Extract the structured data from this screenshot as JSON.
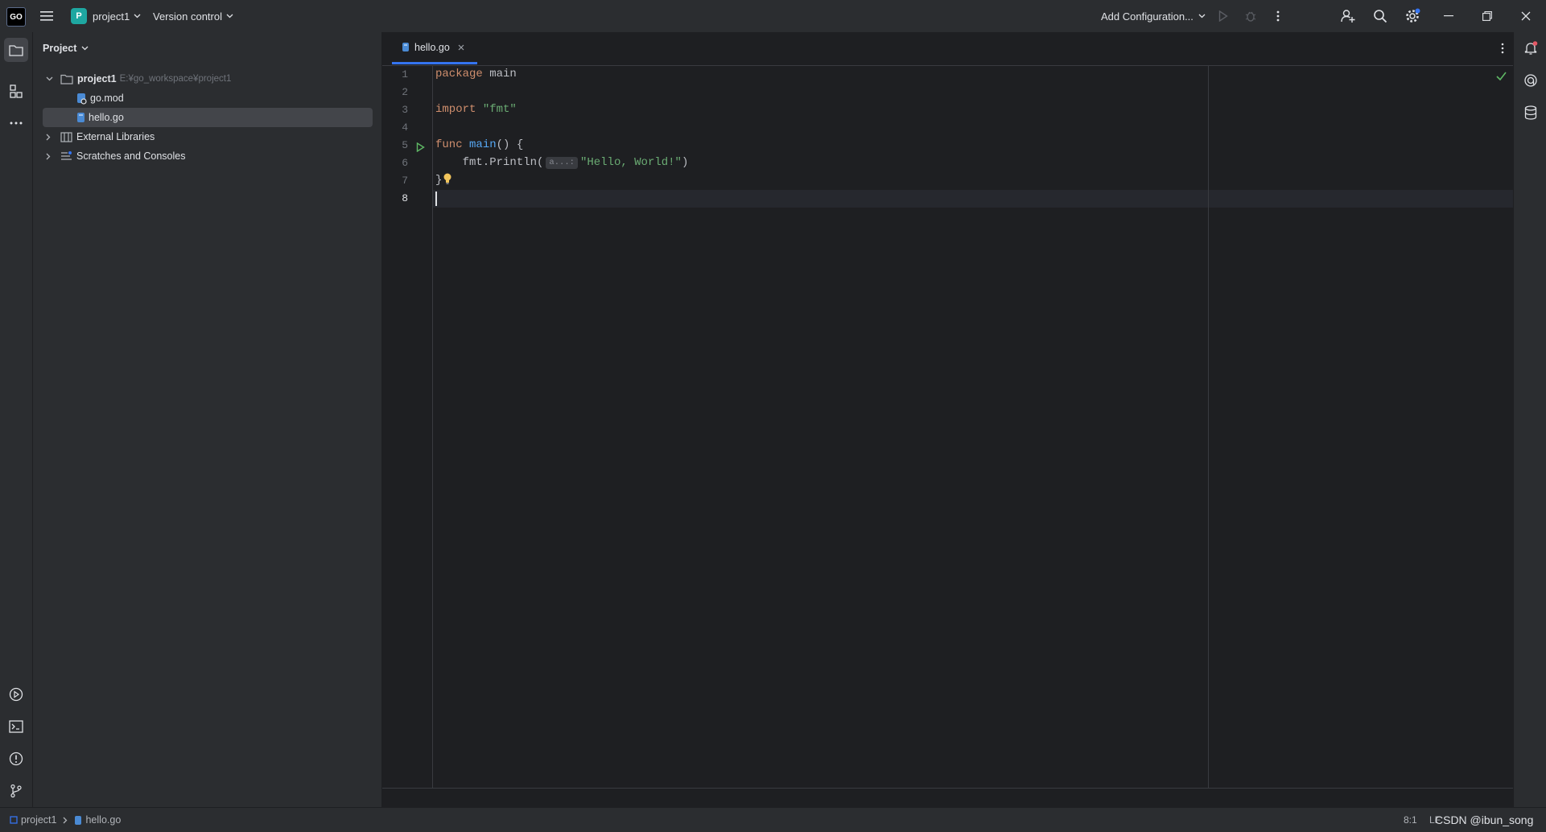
{
  "titlebar": {
    "app_logo": "GO",
    "project_badge": "P",
    "project_name": "project1",
    "version_control": "Version control",
    "run_config": "Add Configuration..."
  },
  "project_panel": {
    "title": "Project",
    "root": {
      "name": "project1",
      "path": "E:¥go_workspace¥project1"
    },
    "files": [
      {
        "name": "go.mod"
      },
      {
        "name": "hello.go"
      }
    ],
    "external_libraries": "External Libraries",
    "scratches": "Scratches and Consoles"
  },
  "editor": {
    "tab_label": "hello.go",
    "line_numbers": [
      "1",
      "2",
      "3",
      "4",
      "5",
      "6",
      "7",
      "8"
    ],
    "code": {
      "l1_kw": "package",
      "l1_rest": " main",
      "l3_kw": "import",
      "l3_str": " \"fmt\"",
      "l5_kw": "func",
      "l5_fn": " main",
      "l5_rest": "() {",
      "l6_pre": "    fmt.Println(",
      "l6_hint": "a...:",
      "l6_str": "\"Hello, World!\"",
      "l6_post": ")",
      "l7": "}"
    }
  },
  "statusbar": {
    "breadcrumb_project": "project1",
    "breadcrumb_file": "hello.go",
    "position": "8:1",
    "line_sep": "LF",
    "watermark": "CSDN @ibun_song"
  },
  "colors": {
    "accent": "#3574f0",
    "keyword": "#cf8e6d",
    "function": "#56a8f5",
    "string": "#6aab73",
    "run_green": "#5fb865"
  }
}
